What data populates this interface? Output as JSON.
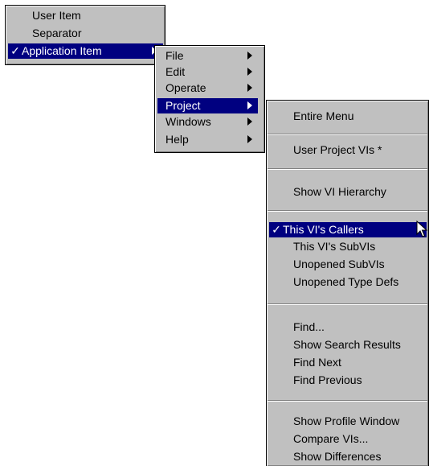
{
  "menu1": {
    "items": [
      {
        "label": "User Item",
        "checked": false,
        "submenu": false
      },
      {
        "label": "Separator",
        "checked": false,
        "submenu": false
      },
      {
        "label": "Application Item",
        "checked": true,
        "submenu": true,
        "highlighted": true
      }
    ],
    "check_mark": "✓"
  },
  "menu2": {
    "items": [
      {
        "label": "File"
      },
      {
        "label": "Edit"
      },
      {
        "label": "Operate"
      },
      {
        "label": "Project",
        "highlighted": true
      },
      {
        "label": "Windows"
      },
      {
        "label": "Help"
      }
    ]
  },
  "menu3": {
    "groups": [
      [
        "Entire Menu"
      ],
      [
        "User Project VIs *"
      ],
      [
        "Show VI Hierarchy"
      ],
      [
        "This VI's Callers",
        "This VI's SubVIs",
        "Unopened SubVIs",
        "Unopened Type Defs"
      ],
      [
        "Find...",
        "Show Search Results",
        "Find Next",
        "Find Previous"
      ],
      [
        "Show Profile Window",
        "Compare VIs...",
        "Show Differences"
      ]
    ],
    "selected": "This VI's Callers",
    "selected_checked": true
  },
  "colors": {
    "menu_bg": "#c0c0c0",
    "highlight_bg": "#000080",
    "highlight_text": "#ffffff"
  },
  "icons": {
    "pointer": "mouse-pointer-icon",
    "submenu_arrow": "submenu-arrow-icon",
    "check": "check-icon"
  }
}
